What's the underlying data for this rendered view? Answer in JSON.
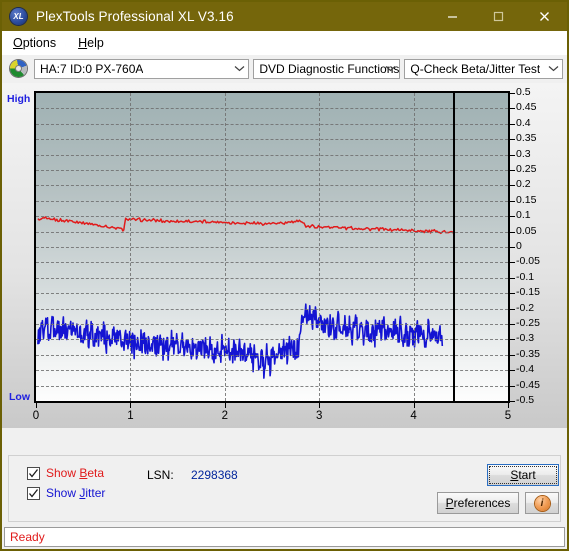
{
  "window": {
    "title": "PlexTools Professional XL V3.16",
    "icon": "XL",
    "icon_name": "plextools-logo-icon",
    "minimize": "minimize-icon",
    "maximize": "maximize-icon",
    "close": "close-icon"
  },
  "menu": {
    "items": [
      {
        "label": "Options",
        "accel": "O"
      },
      {
        "label": "Help",
        "accel": "H"
      }
    ]
  },
  "toolbar": {
    "drive_icon": "optical-disc-icon",
    "drive_select": "HA:7 ID:0  PX-760A",
    "function_select": "DVD Diagnostic Functions",
    "test_select": "Q-Check Beta/Jitter Test"
  },
  "controls": {
    "show_beta": {
      "label": "Show Beta",
      "accel": "B",
      "checked": true,
      "color": "#e01b1b"
    },
    "show_jitter": {
      "label": "Show Jitter",
      "accel": "J",
      "checked": true,
      "color": "#1414d2"
    },
    "lsn_label": "LSN:",
    "lsn_value": "2298368",
    "start_button": {
      "label": "Start",
      "accel": "S"
    },
    "preferences_button": {
      "label": "Preferences",
      "accel": "P"
    },
    "info_button": {
      "label": "i",
      "name": "info-icon"
    }
  },
  "status": {
    "text": "Ready"
  },
  "chart_data": {
    "type": "line",
    "title": "Q-Check Beta/Jitter Test",
    "xlabel": "",
    "ylabel": "",
    "xlim": [
      0,
      5
    ],
    "ylim": [
      -0.5,
      0.5
    ],
    "grid": true,
    "legend_position": "bottom-left",
    "left_axis_top_label": "High",
    "left_axis_bottom_label": "Low",
    "xticks": [
      "0",
      "1",
      "2",
      "3",
      "4",
      "5"
    ],
    "yticks": [
      "0.5",
      "0.45",
      "0.4",
      "0.35",
      "0.3",
      "0.25",
      "0.2",
      "0.15",
      "0.1",
      "0.05",
      "0",
      "-0.05",
      "-0.1",
      "-0.15",
      "-0.2",
      "-0.25",
      "-0.3",
      "-0.35",
      "-0.4",
      "-0.45",
      "-0.5"
    ],
    "data_end_x": 4.42,
    "series": [
      {
        "name": "Beta",
        "color": "#e01b1b",
        "x": [
          0.02,
          0.06,
          0.1,
          0.14,
          0.18,
          0.22,
          0.26,
          0.3,
          0.34,
          0.38,
          0.42,
          0.46,
          0.5,
          0.54,
          0.58,
          0.62,
          0.66,
          0.7,
          0.74,
          0.78,
          0.82,
          0.86,
          0.9,
          0.93,
          0.95,
          0.99,
          1.03,
          1.07,
          1.11,
          1.15,
          1.19,
          1.23,
          1.27,
          1.31,
          1.35,
          1.39,
          1.43,
          1.47,
          1.51,
          1.55,
          1.59,
          1.63,
          1.67,
          1.71,
          1.75,
          1.79,
          1.83,
          1.87,
          1.91,
          1.95,
          1.99,
          2.03,
          2.07,
          2.11,
          2.15,
          2.19,
          2.23,
          2.27,
          2.31,
          2.35,
          2.39,
          2.43,
          2.47,
          2.51,
          2.55,
          2.59,
          2.63,
          2.67,
          2.71,
          2.75,
          2.79,
          2.83,
          2.86,
          2.9,
          2.94,
          2.98,
          3.02,
          3.06,
          3.1,
          3.14,
          3.18,
          3.22,
          3.26,
          3.3,
          3.34,
          3.38,
          3.42,
          3.46,
          3.5,
          3.54,
          3.58,
          3.62,
          3.66,
          3.7,
          3.74,
          3.78,
          3.82,
          3.86,
          3.9,
          3.94,
          3.98,
          4.02,
          4.06,
          4.1,
          4.14,
          4.18,
          4.22,
          4.26,
          4.3,
          4.34,
          4.38,
          4.42
        ],
        "y": [
          0.088,
          0.09,
          0.092,
          0.089,
          0.091,
          0.086,
          0.088,
          0.085,
          0.084,
          0.086,
          0.082,
          0.08,
          0.079,
          0.077,
          0.075,
          0.073,
          0.07,
          0.068,
          0.066,
          0.064,
          0.062,
          0.06,
          0.058,
          0.057,
          0.092,
          0.09,
          0.089,
          0.088,
          0.089,
          0.087,
          0.086,
          0.087,
          0.085,
          0.086,
          0.084,
          0.085,
          0.083,
          0.084,
          0.085,
          0.083,
          0.084,
          0.082,
          0.083,
          0.081,
          0.082,
          0.083,
          0.081,
          0.082,
          0.08,
          0.081,
          0.079,
          0.08,
          0.078,
          0.079,
          0.077,
          0.078,
          0.079,
          0.077,
          0.078,
          0.076,
          0.077,
          0.075,
          0.076,
          0.077,
          0.075,
          0.076,
          0.078,
          0.08,
          0.082,
          0.081,
          0.083,
          0.082,
          0.068,
          0.066,
          0.068,
          0.065,
          0.067,
          0.064,
          0.066,
          0.063,
          0.065,
          0.062,
          0.064,
          0.061,
          0.063,
          0.06,
          0.062,
          0.059,
          0.061,
          0.058,
          0.06,
          0.057,
          0.059,
          0.056,
          0.058,
          0.055,
          0.057,
          0.054,
          0.056,
          0.053,
          0.055,
          0.052,
          0.054,
          0.051,
          0.053,
          0.05,
          0.052,
          0.049,
          0.051,
          0.048,
          0.047,
          0.045
        ]
      },
      {
        "name": "Jitter",
        "color": "#1414d2",
        "x": [
          0.02,
          0.05,
          0.08,
          0.11,
          0.14,
          0.17,
          0.2,
          0.23,
          0.26,
          0.29,
          0.32,
          0.35,
          0.38,
          0.41,
          0.44,
          0.47,
          0.5,
          0.53,
          0.56,
          0.59,
          0.62,
          0.65,
          0.68,
          0.71,
          0.74,
          0.77,
          0.8,
          0.83,
          0.86,
          0.89,
          0.92,
          0.95,
          0.98,
          1.01,
          1.04,
          1.07,
          1.1,
          1.13,
          1.16,
          1.19,
          1.22,
          1.25,
          1.28,
          1.31,
          1.34,
          1.37,
          1.4,
          1.43,
          1.46,
          1.49,
          1.52,
          1.55,
          1.58,
          1.61,
          1.64,
          1.67,
          1.7,
          1.73,
          1.76,
          1.79,
          1.82,
          1.85,
          1.88,
          1.91,
          1.94,
          1.97,
          2.0,
          2.03,
          2.06,
          2.09,
          2.12,
          2.15,
          2.18,
          2.21,
          2.24,
          2.27,
          2.3,
          2.33,
          2.36,
          2.39,
          2.42,
          2.45,
          2.48,
          2.51,
          2.54,
          2.57,
          2.6,
          2.63,
          2.66,
          2.69,
          2.72,
          2.75,
          2.78,
          2.81,
          2.84,
          2.87,
          2.9,
          2.93,
          2.96,
          2.99,
          3.02,
          3.05,
          3.08,
          3.11,
          3.14,
          3.17,
          3.2,
          3.23,
          3.26,
          3.29,
          3.32,
          3.35,
          3.38,
          3.41,
          3.44,
          3.47,
          3.5,
          3.53,
          3.56,
          3.59,
          3.62,
          3.65,
          3.68,
          3.71,
          3.74,
          3.77,
          3.8,
          3.83,
          3.86,
          3.89,
          3.92,
          3.95,
          3.98,
          4.01,
          4.04,
          4.07,
          4.1,
          4.13,
          4.16,
          4.19,
          4.22,
          4.25,
          4.28,
          4.31,
          4.34,
          4.37,
          4.4,
          4.42
        ],
        "y": [
          -0.3,
          -0.25,
          -0.29,
          -0.24,
          -0.3,
          -0.225,
          -0.295,
          -0.245,
          -0.29,
          -0.25,
          -0.285,
          -0.248,
          -0.292,
          -0.255,
          -0.29,
          -0.262,
          -0.295,
          -0.268,
          -0.3,
          -0.272,
          -0.302,
          -0.275,
          -0.305,
          -0.278,
          -0.308,
          -0.282,
          -0.31,
          -0.285,
          -0.312,
          -0.288,
          -0.315,
          -0.292,
          -0.318,
          -0.295,
          -0.32,
          -0.298,
          -0.322,
          -0.3,
          -0.325,
          -0.302,
          -0.328,
          -0.305,
          -0.33,
          -0.306,
          -0.332,
          -0.308,
          -0.335,
          -0.31,
          -0.336,
          -0.312,
          -0.338,
          -0.314,
          -0.34,
          -0.315,
          -0.341,
          -0.316,
          -0.342,
          -0.318,
          -0.343,
          -0.32,
          -0.345,
          -0.321,
          -0.346,
          -0.322,
          -0.347,
          -0.323,
          -0.348,
          -0.325,
          -0.35,
          -0.326,
          -0.352,
          -0.328,
          -0.354,
          -0.33,
          -0.358,
          -0.335,
          -0.37,
          -0.345,
          -0.385,
          -0.352,
          -0.395,
          -0.35,
          -0.38,
          -0.34,
          -0.36,
          -0.335,
          -0.35,
          -0.332,
          -0.345,
          -0.33,
          -0.342,
          -0.328,
          -0.34,
          -0.245,
          -0.205,
          -0.25,
          -0.208,
          -0.245,
          -0.215,
          -0.255,
          -0.218,
          -0.258,
          -0.228,
          -0.265,
          -0.235,
          -0.27,
          -0.24,
          -0.275,
          -0.245,
          -0.278,
          -0.25,
          -0.28,
          -0.252,
          -0.282,
          -0.255,
          -0.285,
          -0.256,
          -0.286,
          -0.258,
          -0.288,
          -0.259,
          -0.289,
          -0.26,
          -0.29,
          -0.261,
          -0.291,
          -0.262,
          -0.292,
          -0.263,
          -0.293,
          -0.264,
          -0.294,
          -0.265,
          -0.295,
          -0.266,
          -0.296,
          -0.267,
          -0.297,
          -0.268,
          -0.298,
          -0.27,
          -0.3,
          -0.275,
          -0.305
        ]
      }
    ]
  }
}
